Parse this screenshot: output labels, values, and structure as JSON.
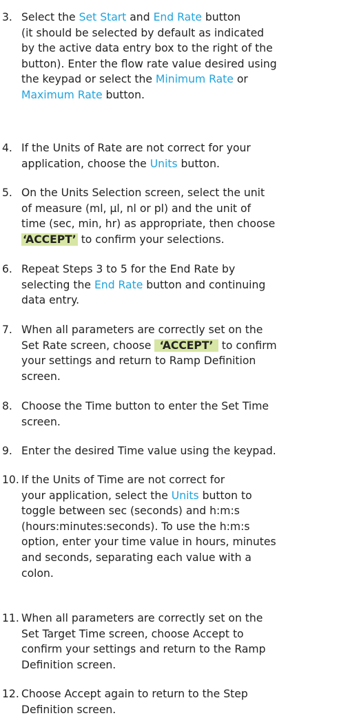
{
  "steps": [
    {
      "number": "3.",
      "lines": [
        [
          {
            "t": "Select the "
          },
          {
            "t": "Set Start",
            "s": "link"
          },
          {
            "t": " and "
          },
          {
            "t": "End Rate",
            "s": "link"
          },
          {
            "t": " button"
          }
        ],
        [
          {
            "t": "(it should be selected by default as indicated"
          }
        ],
        [
          {
            "t": "by the active data entry box to the right of the"
          }
        ],
        [
          {
            "t": "button). Enter the flow rate value desired using"
          }
        ],
        [
          {
            "t": "the keypad or select the "
          },
          {
            "t": "Minimum Rate",
            "s": "link"
          },
          {
            "t": " or"
          }
        ],
        [
          {
            "t": "Maximum Rate",
            "s": "link"
          },
          {
            "t": " button."
          }
        ]
      ]
    },
    {
      "number": "4.",
      "lines": [
        [
          {
            "t": "If the Units of Rate are not correct for your"
          }
        ],
        [
          {
            "t": "application, choose the "
          },
          {
            "t": "Units",
            "s": "link"
          },
          {
            "t": " button."
          }
        ]
      ]
    },
    {
      "number": "5.",
      "lines": [
        [
          {
            "t": "On the Units Selection screen, select the unit"
          }
        ],
        [
          {
            "t": "of measure (ml, µl, nl or pl) and the unit of"
          }
        ],
        [
          {
            "t": "time (sec, min, hr) as appropriate, then choose"
          }
        ],
        [
          {
            "t": "‘ACCEPT’",
            "s": "hl"
          },
          {
            "t": " to confirm your selections."
          }
        ]
      ]
    },
    {
      "number": "6.",
      "lines": [
        [
          {
            "t": "Repeat Steps 3 to 5 for the End Rate by"
          }
        ],
        [
          {
            "t": "selecting the "
          },
          {
            "t": "End Rate",
            "s": "link"
          },
          {
            "t": " button and continuing"
          }
        ],
        [
          {
            "t": "data entry."
          }
        ]
      ]
    },
    {
      "number": "7.",
      "lines": [
        [
          {
            "t": "When all parameters are correctly set on the"
          }
        ],
        [
          {
            "t": "Set Rate screen, choose "
          },
          {
            "t": " ‘ACCEPT’ ",
            "s": "hl"
          },
          {
            "t": " to confirm"
          }
        ],
        [
          {
            "t": "your settings and return to Ramp Definition"
          }
        ],
        [
          {
            "t": "screen."
          }
        ]
      ]
    },
    {
      "number": "8.",
      "lines": [
        [
          {
            "t": "Choose the Time button to enter the Set Time"
          }
        ],
        [
          {
            "t": "screen."
          }
        ]
      ]
    },
    {
      "number": "9.",
      "lines": [
        [
          {
            "t": "Enter the desired Time value using the keypad."
          }
        ]
      ]
    },
    {
      "number": "10.",
      "lines": [
        [
          {
            "t": "If the Units of Time are not correct for"
          }
        ],
        [
          {
            "t": "your application, select the "
          },
          {
            "t": "Units",
            "s": "link"
          },
          {
            "t": " button to"
          }
        ],
        [
          {
            "t": "toggle between sec (seconds) and h:m:s"
          }
        ],
        [
          {
            "t": "(hours:minutes:seconds). To use the h:m:s"
          }
        ],
        [
          {
            "t": "option, enter your time value in hours, minutes"
          }
        ],
        [
          {
            "t": "and seconds, separating each value with a"
          }
        ],
        [
          {
            "t": "colon."
          }
        ]
      ]
    },
    {
      "number": "11.",
      "lines": [
        [
          {
            "t": "When all parameters are correctly set on the"
          }
        ],
        [
          {
            "t": "Set Target Time screen, choose Accept to"
          }
        ],
        [
          {
            "t": "confirm your settings and return to the Ramp"
          }
        ],
        [
          {
            "t": "Definition screen."
          }
        ]
      ]
    },
    {
      "number": "12.",
      "lines": [
        [
          {
            "t": "Choose Accept again to return to the Step"
          }
        ],
        [
          {
            "t": "Definition screen."
          }
        ]
      ]
    }
  ]
}
